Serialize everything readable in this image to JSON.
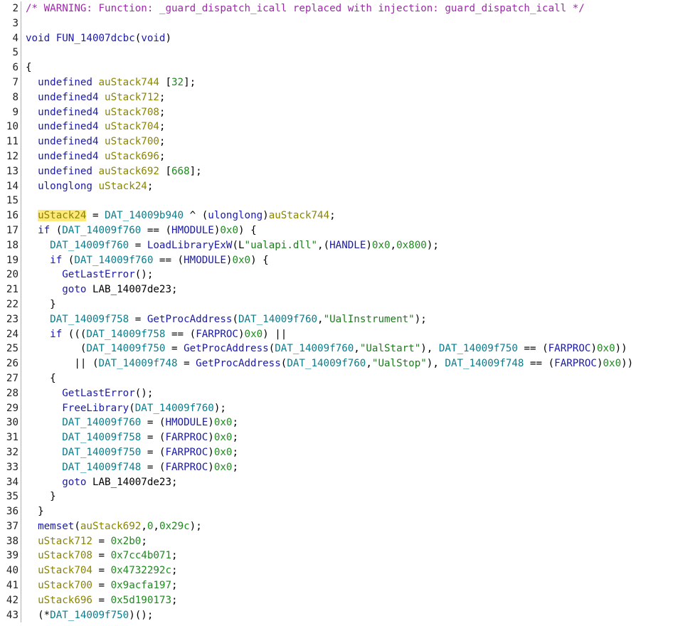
{
  "lines": [
    {
      "n": "2",
      "t": [
        [
          "/* WARNING: Function: _guard_dispatch_icall replaced with injection: guard_dispatch_icall */",
          "cmt"
        ]
      ]
    },
    {
      "n": "3",
      "t": []
    },
    {
      "n": "4",
      "t": [
        [
          "void ",
          "type"
        ],
        [
          "FUN_14007dcbc",
          "func"
        ],
        [
          "(",
          "p"
        ],
        [
          "void",
          "type"
        ],
        [
          ")",
          "p"
        ]
      ]
    },
    {
      "n": "5",
      "t": []
    },
    {
      "n": "6",
      "t": [
        [
          "{",
          "p"
        ]
      ]
    },
    {
      "n": "7",
      "t": [
        [
          "  undefined ",
          "type"
        ],
        [
          "auStack744",
          "var"
        ],
        [
          " [",
          "p"
        ],
        [
          "32",
          "num"
        ],
        [
          "];",
          "p"
        ]
      ]
    },
    {
      "n": "8",
      "t": [
        [
          "  undefined4 ",
          "type"
        ],
        [
          "uStack712",
          "var"
        ],
        [
          ";",
          "p"
        ]
      ]
    },
    {
      "n": "9",
      "t": [
        [
          "  undefined4 ",
          "type"
        ],
        [
          "uStack708",
          "var"
        ],
        [
          ";",
          "p"
        ]
      ]
    },
    {
      "n": "10",
      "t": [
        [
          "  undefined4 ",
          "type"
        ],
        [
          "uStack704",
          "var"
        ],
        [
          ";",
          "p"
        ]
      ]
    },
    {
      "n": "11",
      "t": [
        [
          "  undefined4 ",
          "type"
        ],
        [
          "uStack700",
          "var"
        ],
        [
          ";",
          "p"
        ]
      ]
    },
    {
      "n": "12",
      "t": [
        [
          "  undefined4 ",
          "type"
        ],
        [
          "uStack696",
          "var"
        ],
        [
          ";",
          "p"
        ]
      ]
    },
    {
      "n": "13",
      "t": [
        [
          "  undefined ",
          "type"
        ],
        [
          "auStack692",
          "var"
        ],
        [
          " [",
          "p"
        ],
        [
          "668",
          "num"
        ],
        [
          "];",
          "p"
        ]
      ]
    },
    {
      "n": "14",
      "t": [
        [
          "  ulonglong ",
          "type"
        ],
        [
          "uStack24",
          "var"
        ],
        [
          ";",
          "p"
        ]
      ]
    },
    {
      "n": "15",
      "t": []
    },
    {
      "n": "16",
      "t": [
        [
          "  ",
          "p"
        ],
        [
          "uStack24",
          "var hl"
        ],
        [
          " = ",
          "p"
        ],
        [
          "DAT_14009b940",
          "glob"
        ],
        [
          " ^ (",
          "p"
        ],
        [
          "ulonglong",
          "type"
        ],
        [
          ")",
          "p"
        ],
        [
          "auStack744",
          "var"
        ],
        [
          ";",
          "p"
        ]
      ]
    },
    {
      "n": "17",
      "t": [
        [
          "  if",
          "kw"
        ],
        [
          " (",
          "p"
        ],
        [
          "DAT_14009f760",
          "glob"
        ],
        [
          " == (",
          "p"
        ],
        [
          "HMODULE",
          "type"
        ],
        [
          ")",
          "p"
        ],
        [
          "0x0",
          "num"
        ],
        [
          ") {",
          "p"
        ]
      ]
    },
    {
      "n": "18",
      "t": [
        [
          "    DAT_14009f760",
          "glob"
        ],
        [
          " = ",
          "p"
        ],
        [
          "LoadLibraryExW",
          "func"
        ],
        [
          "(L",
          "p"
        ],
        [
          "\"ualapi.dll\"",
          "str"
        ],
        [
          ",(",
          "p"
        ],
        [
          "HANDLE",
          "type"
        ],
        [
          ")",
          "p"
        ],
        [
          "0x0",
          "num"
        ],
        [
          ",",
          "p"
        ],
        [
          "0x800",
          "num"
        ],
        [
          ");",
          "p"
        ]
      ]
    },
    {
      "n": "19",
      "t": [
        [
          "    if",
          "kw"
        ],
        [
          " (",
          "p"
        ],
        [
          "DAT_14009f760",
          "glob"
        ],
        [
          " == (",
          "p"
        ],
        [
          "HMODULE",
          "type"
        ],
        [
          ")",
          "p"
        ],
        [
          "0x0",
          "num"
        ],
        [
          ") {",
          "p"
        ]
      ]
    },
    {
      "n": "20",
      "t": [
        [
          "      GetLastError",
          "func"
        ],
        [
          "();",
          "p"
        ]
      ]
    },
    {
      "n": "21",
      "t": [
        [
          "      goto",
          "kw"
        ],
        [
          " LAB_14007de23;",
          "p"
        ]
      ]
    },
    {
      "n": "22",
      "t": [
        [
          "    }",
          "p"
        ]
      ]
    },
    {
      "n": "23",
      "t": [
        [
          "    DAT_14009f758",
          "glob"
        ],
        [
          " = ",
          "p"
        ],
        [
          "GetProcAddress",
          "func"
        ],
        [
          "(",
          "p"
        ],
        [
          "DAT_14009f760",
          "glob"
        ],
        [
          ",",
          "p"
        ],
        [
          "\"UalInstrument\"",
          "str"
        ],
        [
          ");",
          "p"
        ]
      ]
    },
    {
      "n": "24",
      "t": [
        [
          "    if",
          "kw"
        ],
        [
          " (((",
          "p"
        ],
        [
          "DAT_14009f758",
          "glob"
        ],
        [
          " == (",
          "p"
        ],
        [
          "FARPROC",
          "type"
        ],
        [
          ")",
          "p"
        ],
        [
          "0x0",
          "num"
        ],
        [
          ") ||",
          "p"
        ]
      ]
    },
    {
      "n": "25",
      "t": [
        [
          "         (",
          "p"
        ],
        [
          "DAT_14009f750",
          "glob"
        ],
        [
          " = ",
          "p"
        ],
        [
          "GetProcAddress",
          "func"
        ],
        [
          "(",
          "p"
        ],
        [
          "DAT_14009f760",
          "glob"
        ],
        [
          ",",
          "p"
        ],
        [
          "\"UalStart\"",
          "str"
        ],
        [
          "), ",
          "p"
        ],
        [
          "DAT_14009f750",
          "glob"
        ],
        [
          " == (",
          "p"
        ],
        [
          "FARPROC",
          "type"
        ],
        [
          ")",
          "p"
        ],
        [
          "0x0",
          "num"
        ],
        [
          "))",
          "p"
        ]
      ]
    },
    {
      "n": "26",
      "t": [
        [
          "        || (",
          "p"
        ],
        [
          "DAT_14009f748",
          "glob"
        ],
        [
          " = ",
          "p"
        ],
        [
          "GetProcAddress",
          "func"
        ],
        [
          "(",
          "p"
        ],
        [
          "DAT_14009f760",
          "glob"
        ],
        [
          ",",
          "p"
        ],
        [
          "\"UalStop\"",
          "str"
        ],
        [
          "), ",
          "p"
        ],
        [
          "DAT_14009f748",
          "glob"
        ],
        [
          " == (",
          "p"
        ],
        [
          "FARPROC",
          "type"
        ],
        [
          ")",
          "p"
        ],
        [
          "0x0",
          "num"
        ],
        [
          "))",
          "p"
        ]
      ]
    },
    {
      "n": "27",
      "t": [
        [
          "    {",
          "p"
        ]
      ]
    },
    {
      "n": "28",
      "t": [
        [
          "      GetLastError",
          "func"
        ],
        [
          "();",
          "p"
        ]
      ]
    },
    {
      "n": "29",
      "t": [
        [
          "      FreeLibrary",
          "func"
        ],
        [
          "(",
          "p"
        ],
        [
          "DAT_14009f760",
          "glob"
        ],
        [
          ");",
          "p"
        ]
      ]
    },
    {
      "n": "30",
      "t": [
        [
          "      DAT_14009f760",
          "glob"
        ],
        [
          " = (",
          "p"
        ],
        [
          "HMODULE",
          "type"
        ],
        [
          ")",
          "p"
        ],
        [
          "0x0",
          "num"
        ],
        [
          ";",
          "p"
        ]
      ]
    },
    {
      "n": "31",
      "t": [
        [
          "      DAT_14009f758",
          "glob"
        ],
        [
          " = (",
          "p"
        ],
        [
          "FARPROC",
          "type"
        ],
        [
          ")",
          "p"
        ],
        [
          "0x0",
          "num"
        ],
        [
          ";",
          "p"
        ]
      ]
    },
    {
      "n": "32",
      "t": [
        [
          "      DAT_14009f750",
          "glob"
        ],
        [
          " = (",
          "p"
        ],
        [
          "FARPROC",
          "type"
        ],
        [
          ")",
          "p"
        ],
        [
          "0x0",
          "num"
        ],
        [
          ";",
          "p"
        ]
      ]
    },
    {
      "n": "33",
      "t": [
        [
          "      DAT_14009f748",
          "glob"
        ],
        [
          " = (",
          "p"
        ],
        [
          "FARPROC",
          "type"
        ],
        [
          ")",
          "p"
        ],
        [
          "0x0",
          "num"
        ],
        [
          ";",
          "p"
        ]
      ]
    },
    {
      "n": "34",
      "t": [
        [
          "      goto",
          "kw"
        ],
        [
          " LAB_14007de23;",
          "p"
        ]
      ]
    },
    {
      "n": "35",
      "t": [
        [
          "    }",
          "p"
        ]
      ]
    },
    {
      "n": "36",
      "t": [
        [
          "  }",
          "p"
        ]
      ]
    },
    {
      "n": "37",
      "t": [
        [
          "  memset",
          "func"
        ],
        [
          "(",
          "p"
        ],
        [
          "auStack692",
          "var"
        ],
        [
          ",",
          "p"
        ],
        [
          "0",
          "num"
        ],
        [
          ",",
          "p"
        ],
        [
          "0x29c",
          "num"
        ],
        [
          ");",
          "p"
        ]
      ]
    },
    {
      "n": "38",
      "t": [
        [
          "  uStack712",
          "var"
        ],
        [
          " = ",
          "p"
        ],
        [
          "0x2b0",
          "num"
        ],
        [
          ";",
          "p"
        ]
      ]
    },
    {
      "n": "39",
      "t": [
        [
          "  uStack708",
          "var"
        ],
        [
          " = ",
          "p"
        ],
        [
          "0x7cc4b071",
          "num"
        ],
        [
          ";",
          "p"
        ]
      ]
    },
    {
      "n": "40",
      "t": [
        [
          "  uStack704",
          "var"
        ],
        [
          " = ",
          "p"
        ],
        [
          "0x4732292c",
          "num"
        ],
        [
          ";",
          "p"
        ]
      ]
    },
    {
      "n": "41",
      "t": [
        [
          "  uStack700",
          "var"
        ],
        [
          " = ",
          "p"
        ],
        [
          "0x9acfa197",
          "num"
        ],
        [
          ";",
          "p"
        ]
      ]
    },
    {
      "n": "42",
      "t": [
        [
          "  uStack696",
          "var"
        ],
        [
          " = ",
          "p"
        ],
        [
          "0x5d190173",
          "num"
        ],
        [
          ";",
          "p"
        ]
      ]
    },
    {
      "n": "43",
      "t": [
        [
          "  (*",
          "p"
        ],
        [
          "DAT_14009f750",
          "glob"
        ],
        [
          ")();",
          "p"
        ]
      ]
    }
  ]
}
